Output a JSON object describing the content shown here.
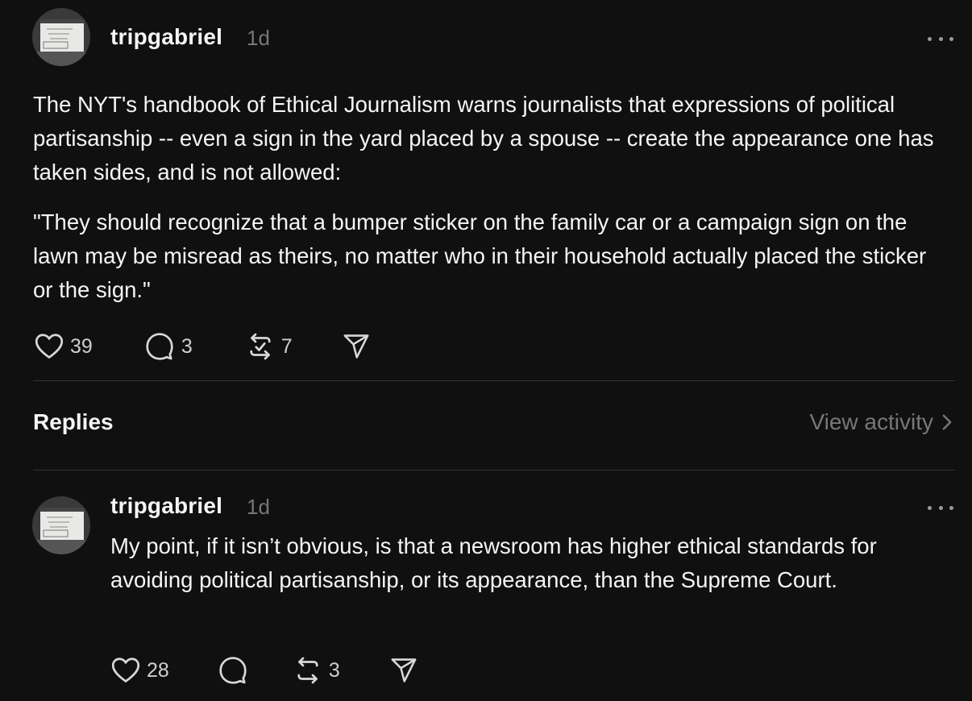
{
  "post": {
    "username": "tripgabriel",
    "time": "1d",
    "paragraphs": [
      "The NYT's handbook of Ethical Journalism warns journalists that expressions of political partisanship -- even a sign in the yard placed by a spouse -- create the appearance one has taken sides, and is not allowed:",
      "\"They should recognize that a bumper sticker on the family car or a campaign sign on the lawn may be misread as theirs, no matter who in their household actually placed the sticker or the sign.\""
    ],
    "likes": "39",
    "comments": "3",
    "reposts": "7"
  },
  "replies_section": {
    "title": "Replies",
    "view_activity": "View activity"
  },
  "reply": {
    "username": "tripgabriel",
    "time": "1d",
    "text": "My point, if it isn’t obvious, is that a newsroom has higher ethical standards for avoiding political partisanship, or its appearance, than the Supreme Court.",
    "likes": "28",
    "reposts": "3"
  },
  "icons": {
    "like": "heart-icon",
    "comment": "comment-bubble-icon",
    "repost": "repost-icon",
    "share": "send-icon",
    "more": "more-horizontal-icon",
    "chevron": "chevron-right-icon"
  },
  "colors": {
    "background": "#101010",
    "text": "#f3f5f7",
    "muted": "#777777",
    "divider": "#333333"
  }
}
